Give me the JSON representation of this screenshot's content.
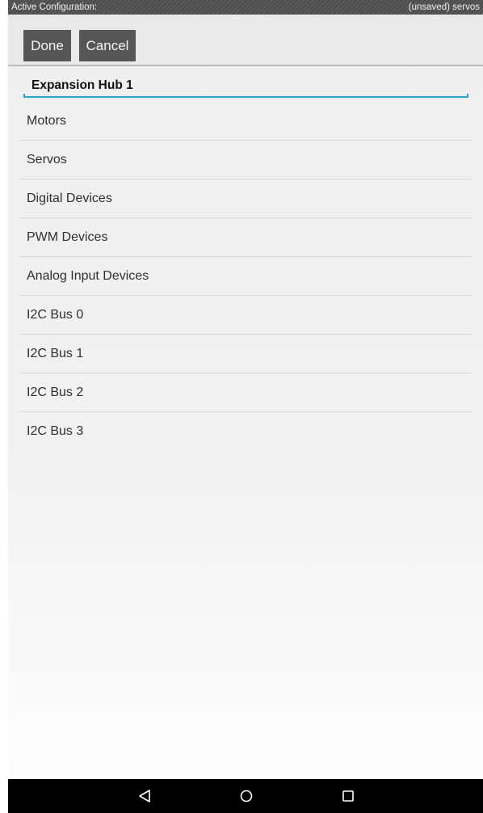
{
  "status_bar": {
    "label": "Active Configuration:",
    "config_name": "(unsaved) servos"
  },
  "toolbar": {
    "done_label": "Done",
    "cancel_label": "Cancel"
  },
  "hub": {
    "name": "Expansion Hub 1",
    "accent_color": "#29a3d6"
  },
  "device_list": {
    "items": [
      {
        "label": "Motors"
      },
      {
        "label": "Servos"
      },
      {
        "label": "Digital Devices"
      },
      {
        "label": "PWM Devices"
      },
      {
        "label": "Analog Input Devices"
      },
      {
        "label": "I2C Bus 0"
      },
      {
        "label": "I2C Bus 1"
      },
      {
        "label": "I2C Bus 2"
      },
      {
        "label": "I2C Bus 3"
      }
    ]
  },
  "nav_bar": {
    "icons": [
      "back-icon",
      "home-icon",
      "recents-icon"
    ]
  }
}
